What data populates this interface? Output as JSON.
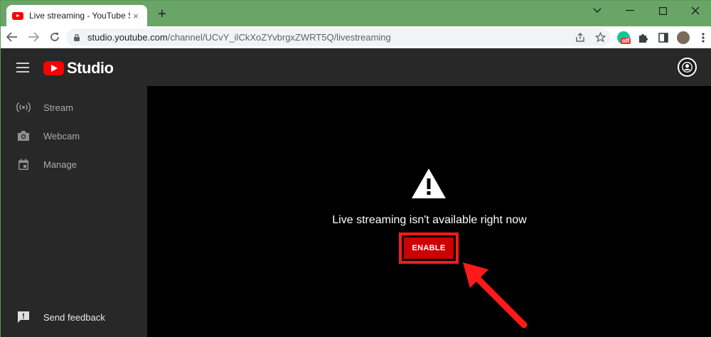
{
  "browser": {
    "tab_title": "Live streaming - YouTube Studio",
    "tab_close": "×",
    "new_tab": "+",
    "url_host": "studio.youtube.com",
    "url_path": "/channel/UCvY_ilCkXoZYvbrgxZWRT5Q/livestreaming",
    "grammarly_badge": "off"
  },
  "app": {
    "logo_text": "Studio"
  },
  "sidebar": {
    "items": [
      {
        "label": "Stream",
        "icon": "broadcast-icon"
      },
      {
        "label": "Webcam",
        "icon": "camera-icon"
      },
      {
        "label": "Manage",
        "icon": "calendar-icon"
      }
    ],
    "feedback_label": "Send feedback"
  },
  "main": {
    "message": "Live streaming isn't available right now",
    "enable_label": "ENABLE"
  },
  "colors": {
    "brand_red": "#ff0000",
    "button_red": "#cc0000",
    "highlight_red": "#ff1a1a",
    "tabstrip_green": "#68a566",
    "sidebar_bg": "#282828",
    "main_bg": "#000000"
  }
}
